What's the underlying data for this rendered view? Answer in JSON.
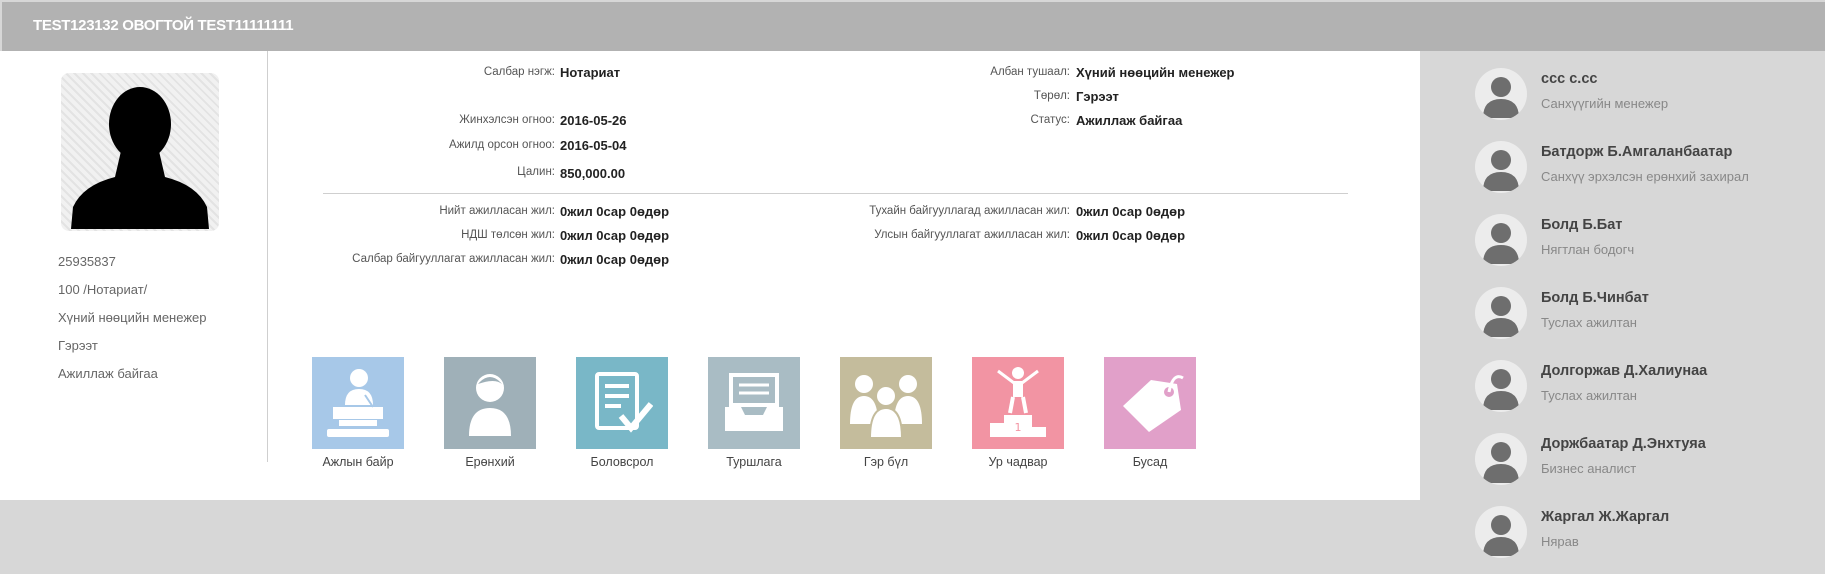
{
  "header": {
    "title": "TEST123132 ОВОГТОЙ TEST11111111"
  },
  "profile": {
    "id": "25935837",
    "branch": "100 /Нотариат/",
    "position": "Хүний нөөцийн менежер",
    "type": "Гэрээт",
    "status": "Ажиллаж байгаа"
  },
  "info": {
    "branch_unit": {
      "label": "Салбар нэгж:",
      "value": "Нотариат"
    },
    "job_title": {
      "label": "Албан тушаал:",
      "value": "Хүний нөөцийн менежер"
    },
    "type": {
      "label": "Төрөл:",
      "value": "Гэрээт"
    },
    "hired_date": {
      "label": "Жинхэлсэн огноо:",
      "value": "2016-05-26"
    },
    "status": {
      "label": "Статус:",
      "value": "Ажиллаж байгаа"
    },
    "start_date": {
      "label": "Ажилд орсон огноо:",
      "value": "2016-05-04"
    },
    "salary": {
      "label": "Цалин:",
      "value": "850,000.00"
    },
    "total_years": {
      "label": "Нийт ажилласан жил:",
      "value": "0жил 0сар 0өдөр"
    },
    "company_years": {
      "label": "Тухайн байгууллагад ажилласан жил:",
      "value": "0жил 0сар 0өдөр"
    },
    "ndsh_years": {
      "label": "НДШ төлсөн жил:",
      "value": "0жил 0сар 0өдөр"
    },
    "state_years": {
      "label": "Улсын байгууллагат ажилласан жил:",
      "value": "0жил 0сар 0өдөр"
    },
    "sector_years": {
      "label": "Салбар байгууллагат ажилласан жил:",
      "value": "0жил 0сар 0өдөр"
    }
  },
  "tiles": [
    {
      "label": "Ажлын байр",
      "color": "#a7c8e8",
      "icon": "podium-speaker-icon"
    },
    {
      "label": "Ерөнхий",
      "color": "#9fb0b8",
      "icon": "person-icon"
    },
    {
      "label": "Боловсрол",
      "color": "#79b7c7",
      "icon": "document-check-icon"
    },
    {
      "label": "Туршлага",
      "color": "#a9bcc4",
      "icon": "archive-tray-icon"
    },
    {
      "label": "Гэр бүл",
      "color": "#c4bc9c",
      "icon": "family-icon"
    },
    {
      "label": "Ур чадвар",
      "color": "#f294a3",
      "icon": "winner-podium-icon"
    },
    {
      "label": "Бусад",
      "color": "#e1a0c9",
      "icon": "tag-icon"
    }
  ],
  "staff": [
    {
      "name": "ccc c.cc",
      "role": "Санхүүгийн менежер"
    },
    {
      "name": "Батдорж Б.Амгаланбаатар",
      "role": "Санхүү эрхэлсэн ерөнхий захирал"
    },
    {
      "name": "Болд Б.Бат",
      "role": "Нягтлан бодогч"
    },
    {
      "name": "Болд Б.Чинбат",
      "role": "Туслах ажилтан"
    },
    {
      "name": "Долгоржав Д.Халиунаа",
      "role": "Туслах ажилтан"
    },
    {
      "name": "Доржбаатар Д.Энхтуяа",
      "role": "Бизнес аналист"
    },
    {
      "name": "Жаргал Ж.Жаргал",
      "role": "Нярав"
    }
  ]
}
